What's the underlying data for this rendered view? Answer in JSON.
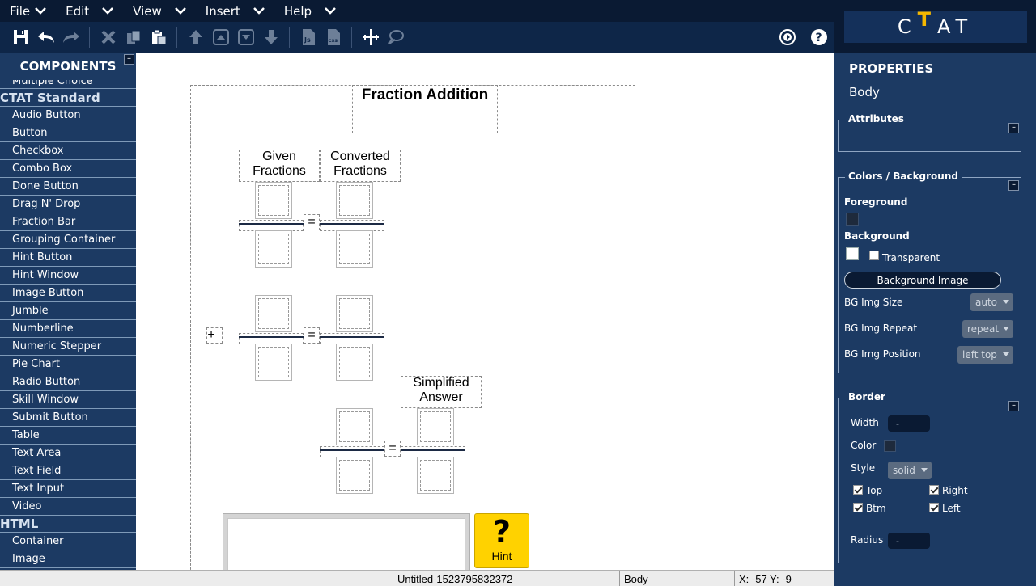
{
  "menubar": {
    "items": [
      {
        "label": "File"
      },
      {
        "label": "Edit"
      },
      {
        "label": "View"
      },
      {
        "label": "Insert"
      },
      {
        "label": "Help"
      }
    ]
  },
  "logo": {
    "text_c": "C",
    "text_t": "T",
    "text_at": "AT"
  },
  "left_panel": {
    "title": "COMPONENTS",
    "partial_item": "Multiple Choice",
    "categories": {
      "ctat": "CTAT Standard",
      "html": "HTML"
    },
    "ctat_items": [
      "Audio Button",
      "Button",
      "Checkbox",
      "Combo Box",
      "Done Button",
      "Drag N' Drop",
      "Fraction Bar",
      "Grouping Container",
      "Hint Button",
      "Hint Window",
      "Image Button",
      "Jumble",
      "Numberline",
      "Numeric Stepper",
      "Pie Chart",
      "Radio Button",
      "Skill Window",
      "Submit Button",
      "Table",
      "Text Area",
      "Text Field",
      "Text Input",
      "Video"
    ],
    "html_items": [
      "Container",
      "Image"
    ],
    "collapse_glyph": "–"
  },
  "canvas": {
    "title": "Fraction Addition",
    "given_label": "Given\nFractions",
    "given_line1": "Given",
    "given_line2": "Fractions",
    "converted_line1": "Converted",
    "converted_line2": "Fractions",
    "simplified_line1": "Simplified",
    "simplified_line2": "Answer",
    "equals": "=",
    "plus": "+",
    "hint_glyph": "?",
    "hint_label": "Hint"
  },
  "properties": {
    "title": "PROPERTIES",
    "selected": "Body",
    "attributes_legend": "Attributes",
    "colors_legend": "Colors / Background",
    "foreground_label": "Foreground",
    "background_label": "Background",
    "transparent_label": "Transparent",
    "bg_image_button": "Background Image",
    "bg_img_size_label": "BG Img Size",
    "bg_img_size_value": "auto",
    "bg_img_repeat_label": "BG Img Repeat",
    "bg_img_repeat_value": "repeat",
    "bg_img_position_label": "BG Img Position",
    "bg_img_position_value": "left top",
    "border_legend": "Border",
    "width_label": "Width",
    "width_value": "-",
    "color_label": "Color",
    "style_label": "Style",
    "style_value": "solid",
    "top_label": "Top",
    "right_label": "Right",
    "btm_label": "Btm",
    "left_label": "Left",
    "radius_label": "Radius",
    "radius_value": "-",
    "collapse_glyph": "–",
    "colors": {
      "foreground": "#1e2a3c",
      "background": "#ffffff"
    }
  },
  "statusbar": {
    "filename": "Untitled-1523795832372",
    "element": "Body",
    "coords": "X: -57 Y: -9"
  },
  "theme": {
    "navy": "#0a1a33",
    "panel": "#1c3a63",
    "hint_yellow": "#ffd200"
  }
}
